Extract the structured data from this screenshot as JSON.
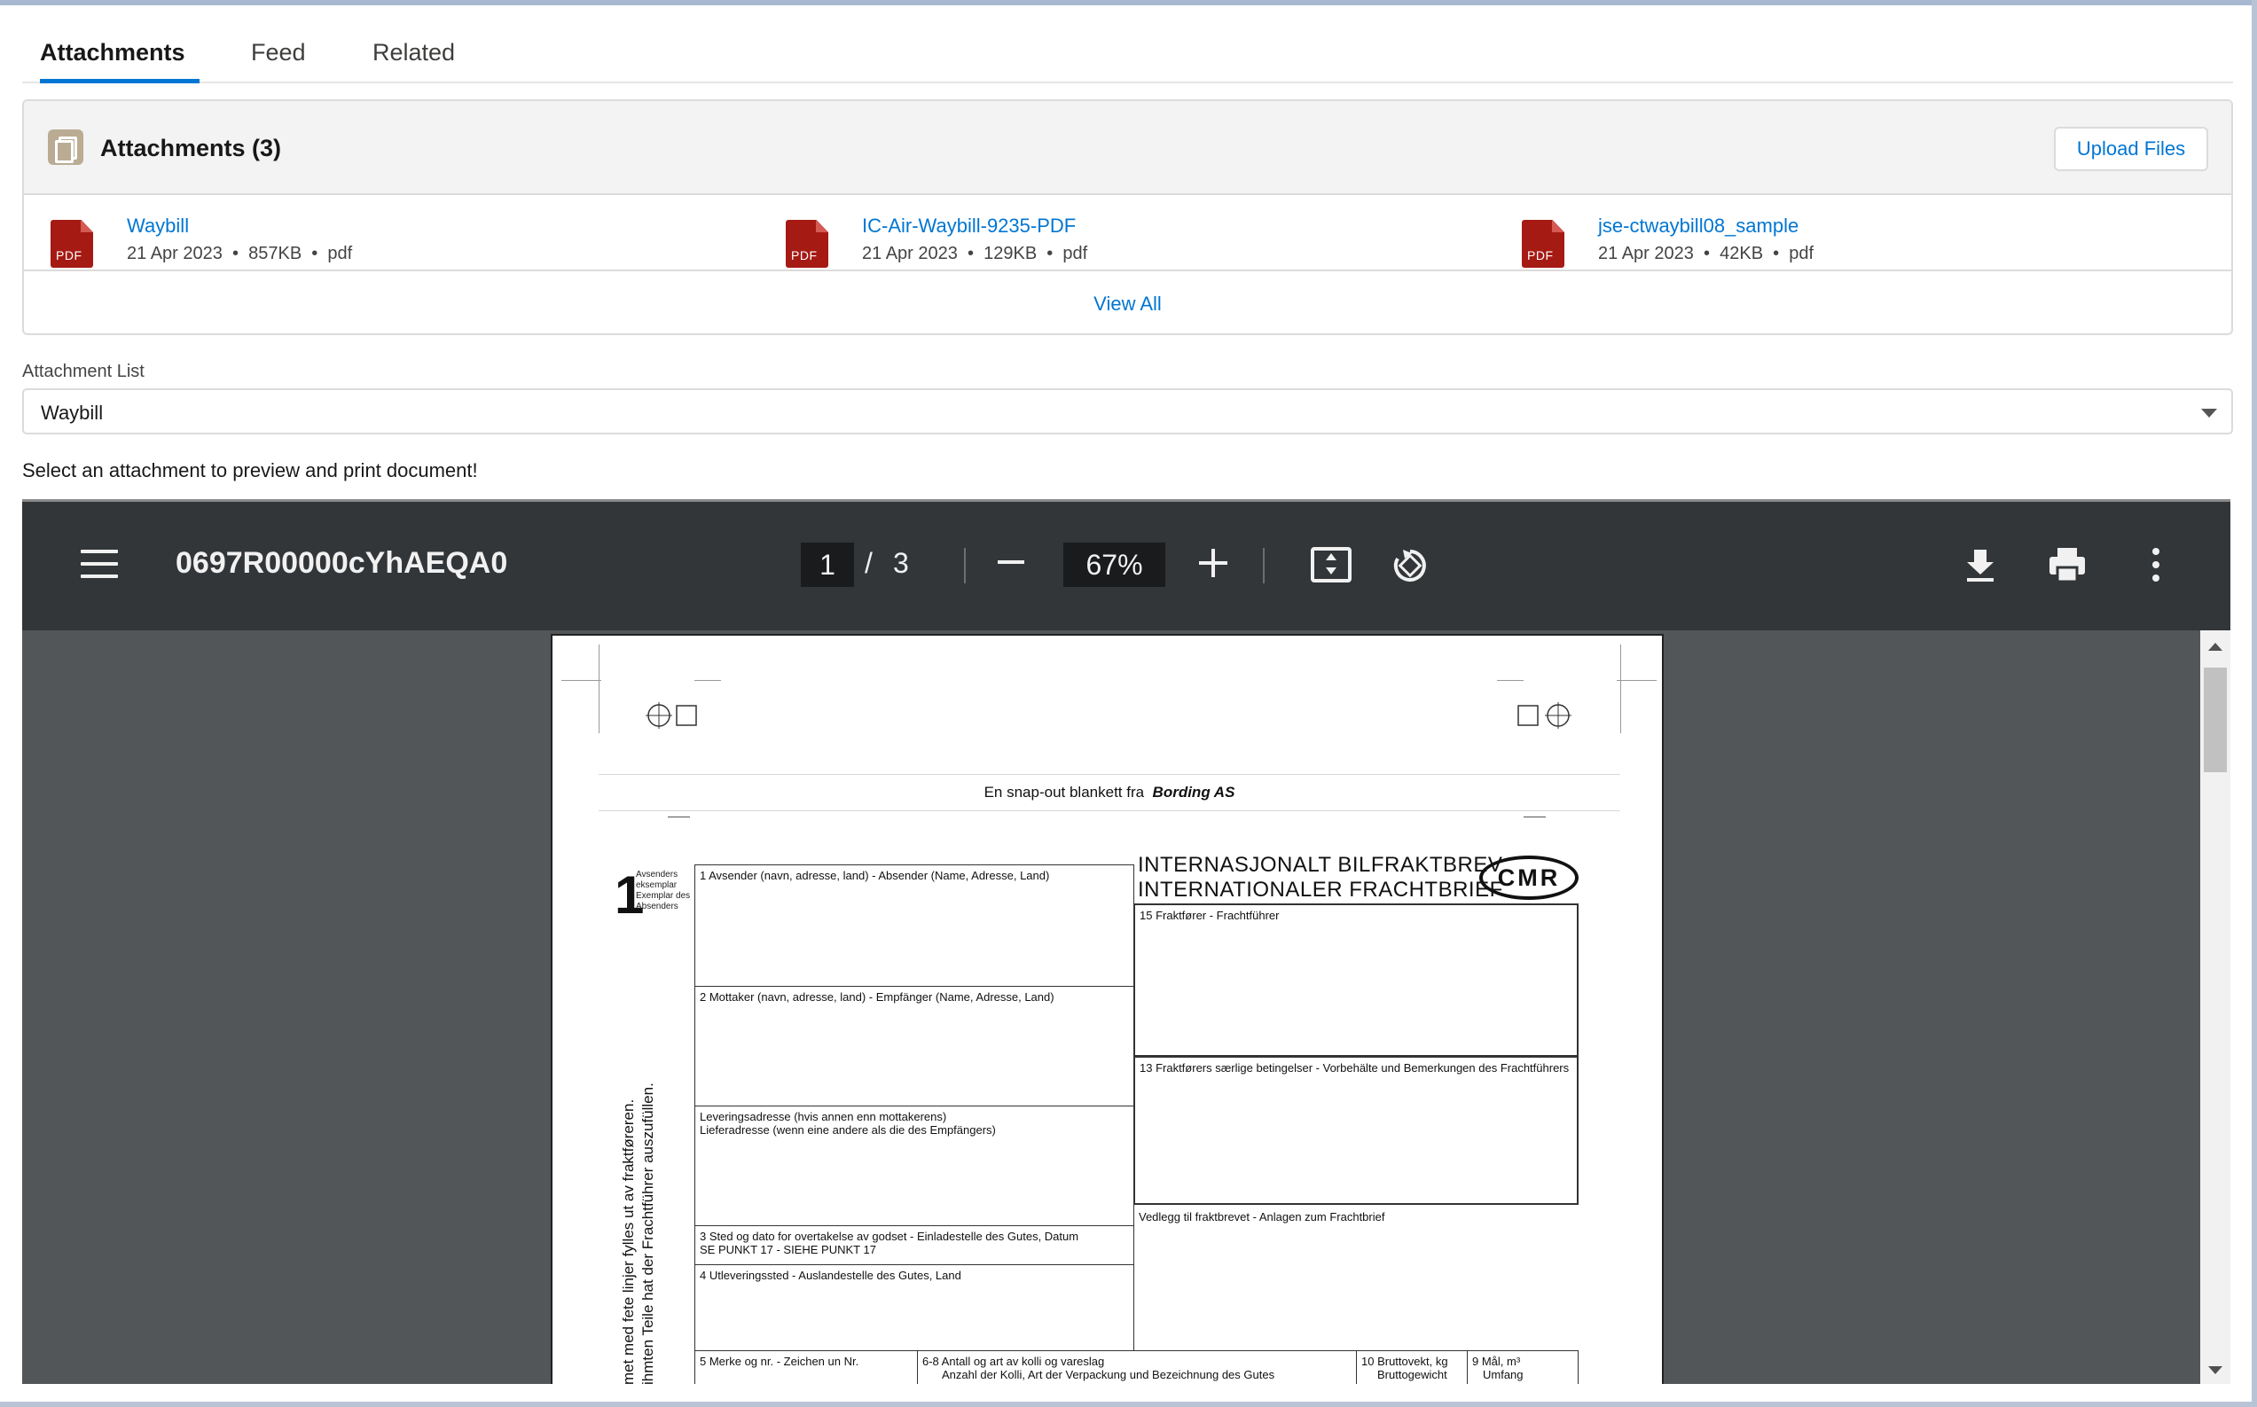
{
  "tabs": [
    {
      "label": "Attachments",
      "active": true
    },
    {
      "label": "Feed",
      "active": false
    },
    {
      "label": "Related",
      "active": false
    }
  ],
  "attachments_card": {
    "title": "Attachments (3)",
    "upload_label": "Upload Files",
    "icon": "files-icon",
    "files": [
      {
        "name": "Waybill",
        "date": "21 Apr 2023",
        "size": "857KB",
        "type": "pdf",
        "icon_label": "PDF"
      },
      {
        "name": "IC-Air-Waybill-9235-PDF",
        "date": "21 Apr 2023",
        "size": "129KB",
        "type": "pdf",
        "icon_label": "PDF"
      },
      {
        "name": "jse-ctwaybill08_sample",
        "date": "21 Apr 2023",
        "size": "42KB",
        "type": "pdf",
        "icon_label": "PDF"
      }
    ],
    "view_all_label": "View All"
  },
  "attachment_list": {
    "label": "Attachment List",
    "selected": "Waybill"
  },
  "hint": "Select an attachment to preview and print document!",
  "viewer": {
    "doc_title": "0697R00000cYhAEQA0",
    "current_page": "1",
    "page_separator": "/",
    "total_pages": "3",
    "zoom": "67%",
    "colors": {
      "toolbar": "#323639",
      "background": "#525659"
    }
  },
  "pdf": {
    "snap_prefix": "En snap-out blankett fra",
    "snap_brand": "Bording AS",
    "copy_number": "1",
    "copy_label_lines": [
      "Avsenders",
      "eksemplar",
      "Exemplar des",
      "Absenders"
    ],
    "title_line1": "INTERNASJONALT  BILFRAKTBREV",
    "title_line2": "INTERNATIONALER  FRACHTBRIEF",
    "cmr": "CMR",
    "rotated_line1": "met med fete linjer fylles ut av fraktføreren.",
    "rotated_line2": "ihmten Teile hat der Frachtführer auszufüllen.",
    "box1": "1 Avsender (navn, adresse, land) - Absender (Name, Adresse, Land)",
    "box2": "2 Mottaker (navn, adresse, land) - Empfänger (Name, Adresse, Land)",
    "box_delivery_1": "Leveringsadresse (hvis annen enn mottakerens)",
    "box_delivery_2": "Lieferadresse (wenn eine andere als die des Empfängers)",
    "box3_1": "3 Sted og dato for overtakelse av godset - Einladestelle des Gutes, Datum",
    "box3_2": "SE PUNKT 17 - SIEHE PUNKT 17",
    "box4": "4 Utleveringssted - Auslandestelle des Gutes, Land",
    "box15": "15 Fraktfører - Frachtführer",
    "box13": "13 Fraktførers særlige betingelser - Vorbehälte und Bemerkungen des Frachtführers",
    "attachments_note": "Vedlegg til fraktbrevet - Anlagen zum Frachtbrief",
    "box5": "5 Merke og nr. - Zeichen un Nr.",
    "box68_1": "6-8 Antall og art av kolli og vareslag",
    "box68_2": "Anzahl der Kolli, Art der Verpackung und Bezeichnung des Gutes",
    "box10_1": "10 Bruttovekt, kg",
    "box10_2": "Bruttogewicht",
    "box9_1": "9 Mål, m³",
    "box9_2": "Umfang"
  }
}
